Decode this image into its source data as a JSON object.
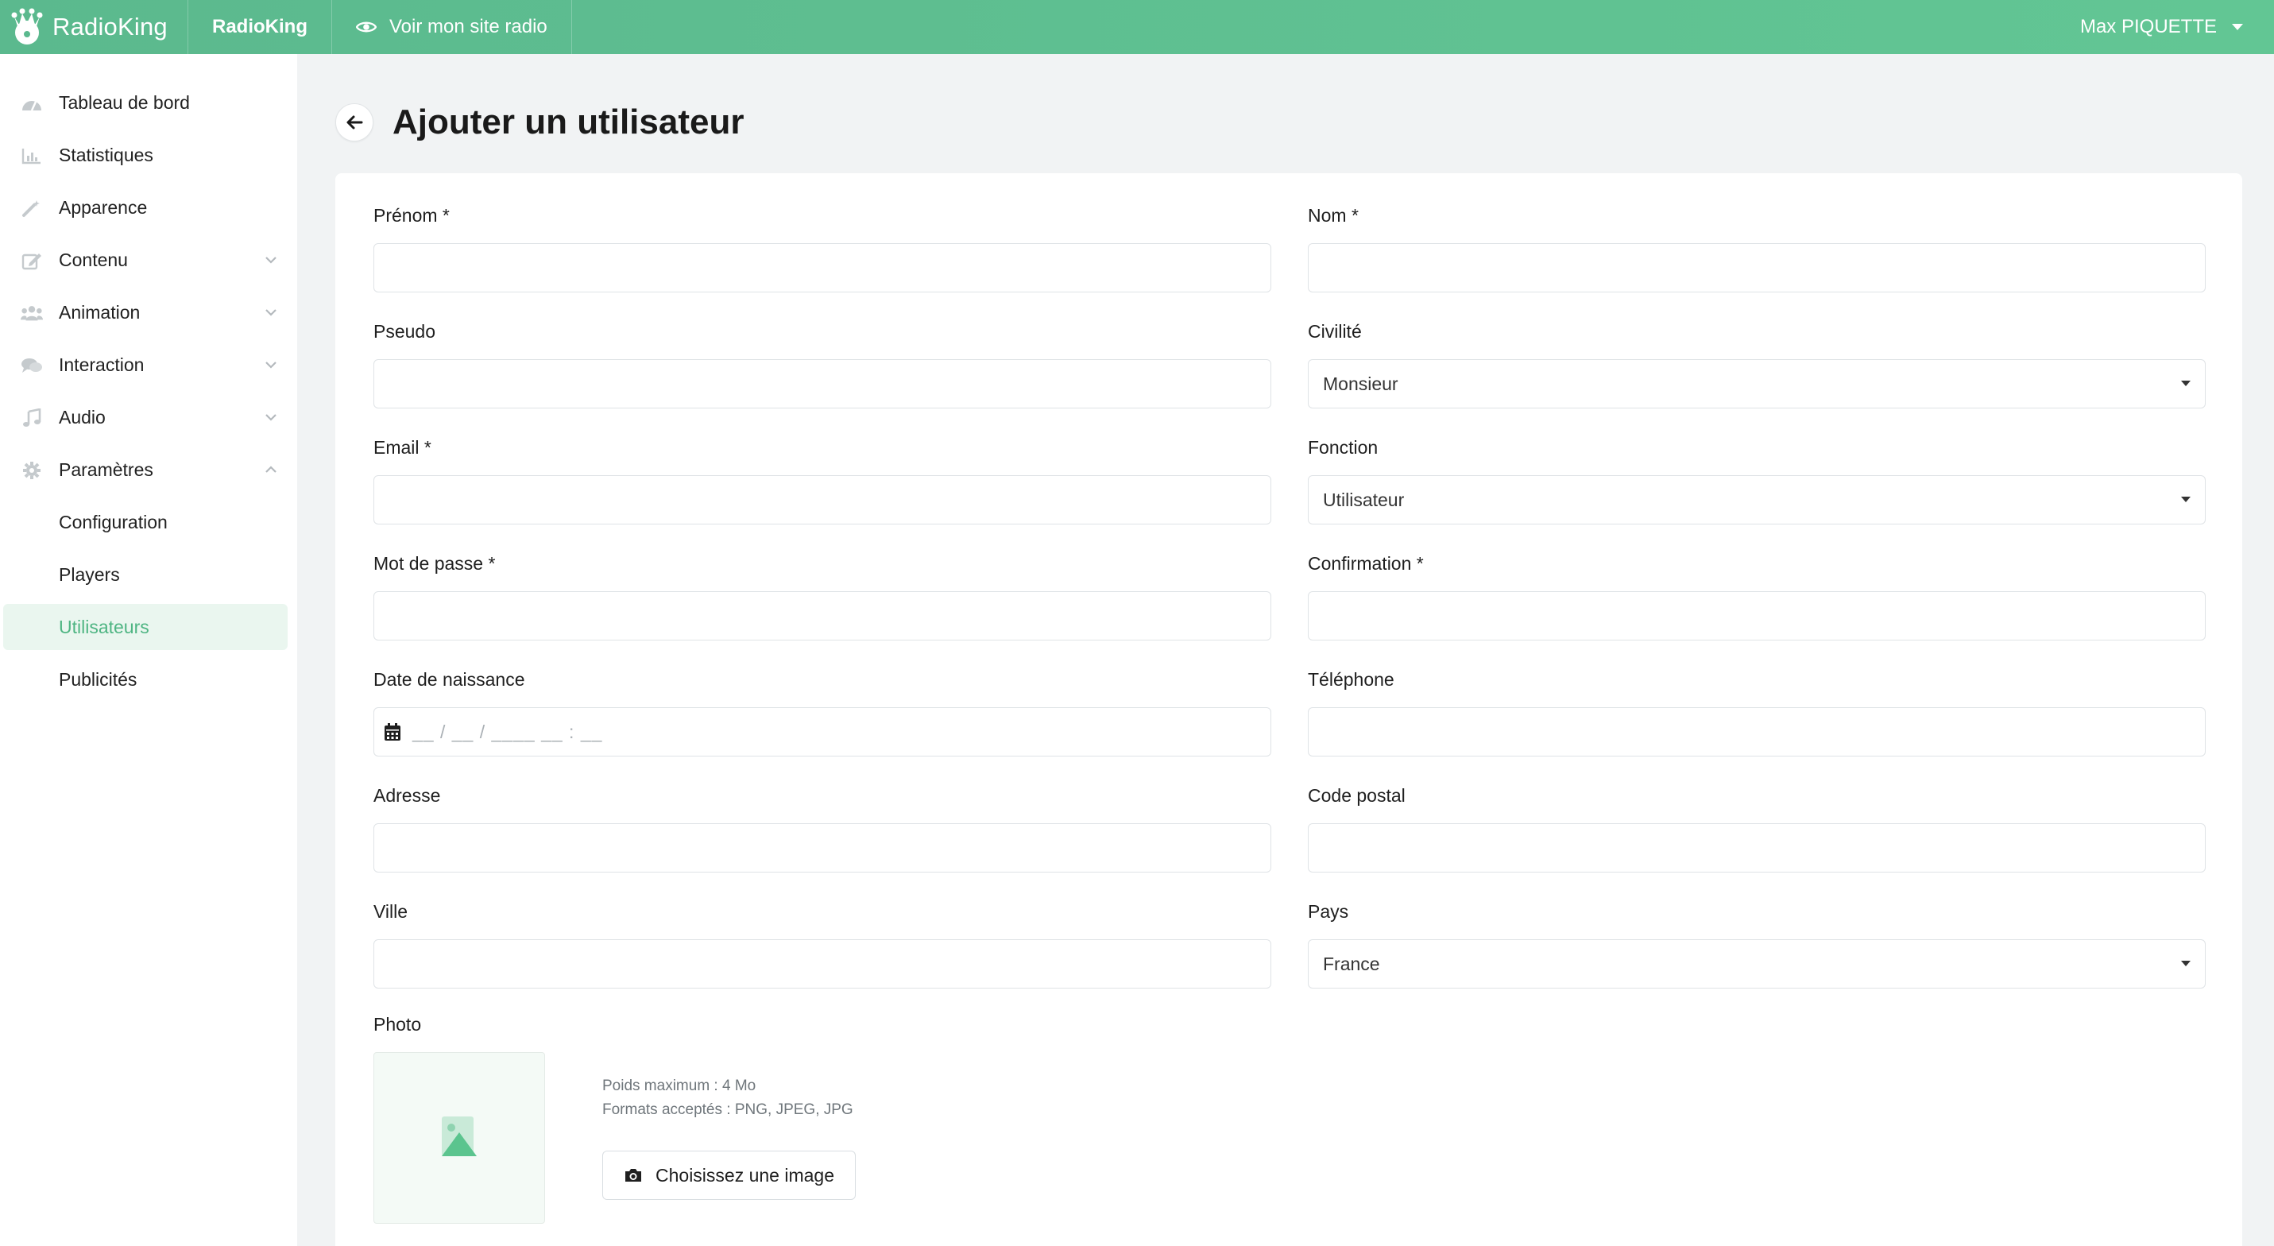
{
  "topbar": {
    "brand_name": "RadioKing",
    "radio_name": "RadioKing",
    "view_site_label": "Voir mon site radio",
    "user_name": "Max PIQUETTE",
    "accent_color": "#5bb98e"
  },
  "sidebar": {
    "items": [
      {
        "label": "Tableau de bord",
        "icon": "dashboard-icon"
      },
      {
        "label": "Statistiques",
        "icon": "chart-icon"
      },
      {
        "label": "Apparence",
        "icon": "magic-wand-icon"
      },
      {
        "label": "Contenu",
        "icon": "edit-icon"
      },
      {
        "label": "Animation",
        "icon": "users-icon"
      },
      {
        "label": "Interaction",
        "icon": "comments-icon"
      },
      {
        "label": "Audio",
        "icon": "music-icon"
      },
      {
        "label": "Paramètres",
        "icon": "gear-icon"
      }
    ],
    "sub_items": [
      {
        "label": "Configuration"
      },
      {
        "label": "Players"
      },
      {
        "label": "Utilisateurs",
        "active": true
      },
      {
        "label": "Publicités"
      }
    ]
  },
  "page": {
    "title": "Ajouter un utilisateur"
  },
  "form": {
    "prenom": {
      "label": "Prénom *",
      "value": ""
    },
    "nom": {
      "label": "Nom *",
      "value": ""
    },
    "pseudo": {
      "label": "Pseudo",
      "value": ""
    },
    "civilite": {
      "label": "Civilité",
      "value": "Monsieur"
    },
    "email": {
      "label": "Email *",
      "value": ""
    },
    "fonction": {
      "label": "Fonction",
      "value": "Utilisateur"
    },
    "password": {
      "label": "Mot de passe *",
      "value": ""
    },
    "confirmation": {
      "label": "Confirmation *",
      "value": ""
    },
    "birthdate": {
      "label": "Date de naissance",
      "placeholder": "__ / __ / ____ __ : __"
    },
    "telephone": {
      "label": "Téléphone",
      "value": ""
    },
    "adresse": {
      "label": "Adresse",
      "value": ""
    },
    "code_postal": {
      "label": "Code postal",
      "value": ""
    },
    "ville": {
      "label": "Ville",
      "value": ""
    },
    "pays": {
      "label": "Pays",
      "value": "France"
    },
    "photo": {
      "label": "Photo",
      "max_weight": "Poids maximum : 4 Mo",
      "formats": "Formats acceptés : PNG, JPEG, JPG",
      "button_label": "Choisissez une image"
    }
  }
}
